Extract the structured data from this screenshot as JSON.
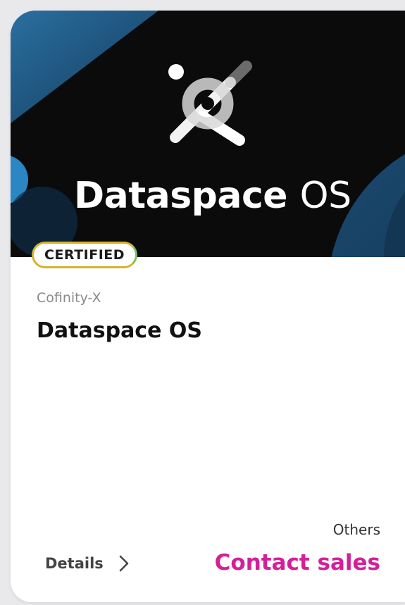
{
  "card": {
    "badge": "CERTIFIED",
    "provider": "Cofinity-X",
    "title": "Dataspace OS",
    "hero": {
      "brand_bold": "Dataspace",
      "brand_light": "OS",
      "background": "#0b0b0c",
      "accent_blue": "#1f5a86"
    },
    "price_type": "Others",
    "details_label": "Details",
    "cta_label": "Contact sales",
    "cta_color": "#d3209a"
  }
}
